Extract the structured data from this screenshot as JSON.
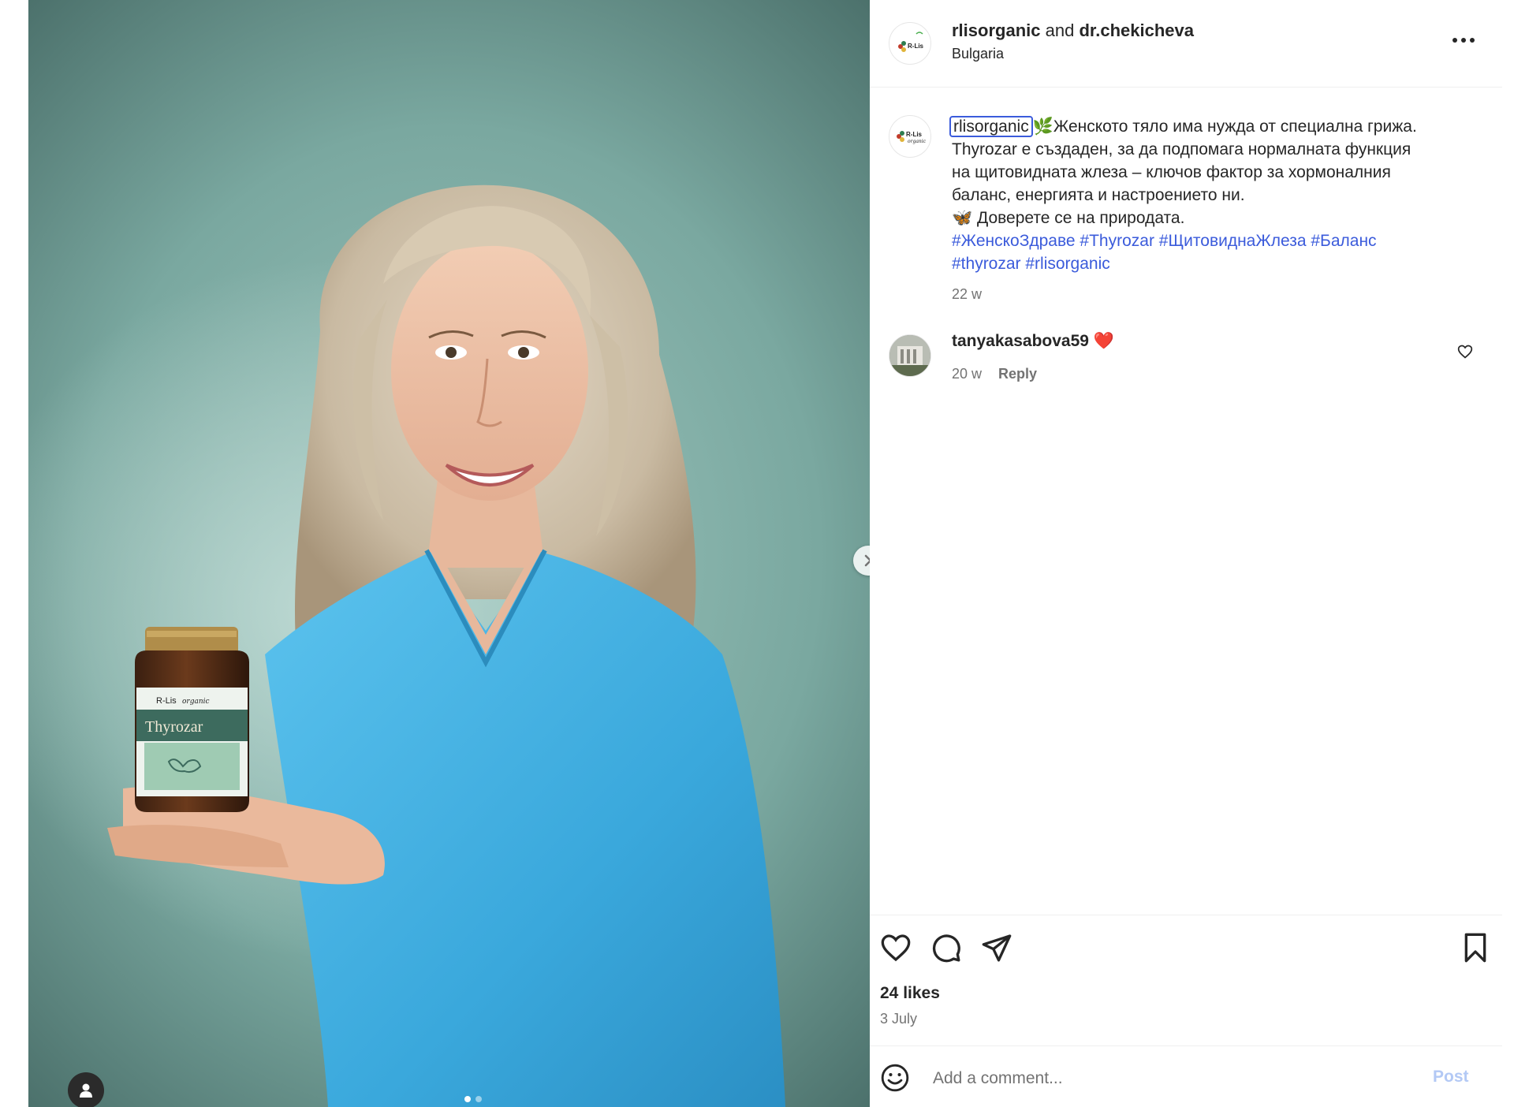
{
  "post": {
    "author": "rlisorganic",
    "connector": "and",
    "coauthor": "dr.chekicheva",
    "location": "Bulgaria",
    "more_icon": "more-horizontal-icon"
  },
  "media": {
    "product_brand": "R-Lis",
    "product_brand_sub": "organic",
    "product_name": "Thyrozar",
    "slide_count": 2,
    "active_slide": 1,
    "next_icon": "chevron-right-icon",
    "tag_icon": "user-tag-icon"
  },
  "caption": {
    "username": "rlisorganic",
    "line1": "🌿Женското тяло има нужда от специална грижа.",
    "line2": "Thyrozar е създаден, за да подпомага нормалната функция",
    "line3": "на щитовидната жлеза – ключов фактор за хормоналния",
    "line4": "баланс, енергията и настроението ни.",
    "line5": "🦋 Доверете се на природата.",
    "hashtags_line1": "#ЖенскоЗдраве #Thyrozar #ЩитовиднаЖлеза #Баланс",
    "hashtags_line2": "#thyrozar #rlisorganic",
    "time": "22 w"
  },
  "comments": [
    {
      "username": "tanyakasabova59",
      "text": "❤️",
      "time": "20 w",
      "reply_label": "Reply"
    }
  ],
  "actions": {
    "like_icon": "heart-icon",
    "comment_icon": "comment-icon",
    "share_icon": "share-icon",
    "save_icon": "bookmark-icon"
  },
  "likes": "24 likes",
  "date": "3 July",
  "comment_box": {
    "placeholder": "Add a comment...",
    "post_label": "Post",
    "emoji_icon": "emoji-icon"
  },
  "colors": {
    "link": "#3b5bdb",
    "muted": "#737373",
    "post_disabled": "#b3c9f5",
    "scrub_blue": "#4ab3e6"
  }
}
